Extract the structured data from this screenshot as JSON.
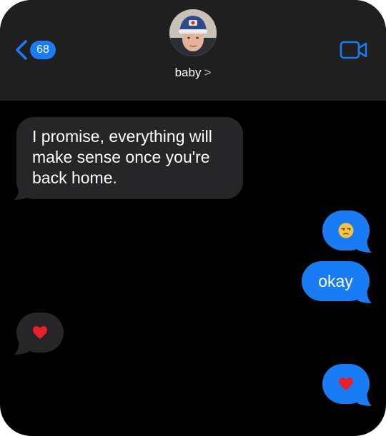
{
  "header": {
    "back_count": "68",
    "contact_name": "baby",
    "chevron": ">"
  },
  "messages": [
    {
      "direction": "incoming",
      "text": "I promise, everything will make sense once you're back home."
    },
    {
      "direction": "outgoing",
      "emoji": "unamused-face-icon"
    },
    {
      "direction": "outgoing",
      "text": "okay"
    },
    {
      "direction": "incoming",
      "emoji": "red-heart-icon"
    },
    {
      "direction": "outgoing",
      "emoji": "red-heart-icon"
    }
  ],
  "colors": {
    "background": "#000000",
    "header": "#1f1f1f",
    "incoming_bubble": "#262628",
    "outgoing_bubble": "#1a7cf5",
    "accent": "#1a7cf5"
  }
}
